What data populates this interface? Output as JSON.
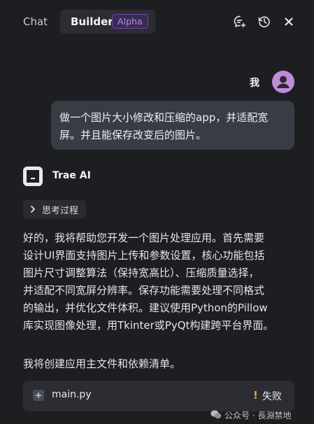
{
  "header": {
    "tabs": [
      {
        "label": "Chat",
        "active": false
      },
      {
        "label": "Builder",
        "active": true,
        "badge": "Alpha"
      }
    ],
    "actions": [
      "new-chat-icon",
      "history-icon",
      "close-icon"
    ]
  },
  "user_message": {
    "author": "我",
    "avatar": "user-avatar-icon",
    "lines": [
      "做一个图片大小修改和压缩的app，并适配宽",
      "屏。并且能保存改变后的图片。"
    ]
  },
  "ai_message": {
    "author": "Trae AI",
    "thinking_label": "思考过程",
    "paragraph_lines": [
      "好的，我将帮助您开发一个图片处理应用。首先需要",
      "设计UI界面支持图片上传和参数设置，核心功能包括",
      "图片尺寸调整算法（保持宽高比）、压缩质量选择，",
      "并适配不同宽屏分辨率。保存功能需要处理不同格式",
      "的输出，并优化文件体积。建议使用Python的Pillow",
      "库实现图像处理，用Tkinter或PyQt构建跨平台界面。"
    ],
    "followup": "我将创建应用主文件和依赖清单。",
    "file": {
      "name": "main.py",
      "status_icon": "!",
      "status": "失败"
    }
  },
  "watermark": {
    "text": "公众号 · 長淵禁地"
  },
  "colors": {
    "background": "#1d1e22",
    "accent": "#b589f5",
    "error": "#f0a13a",
    "avatar": "#c28bd8"
  }
}
